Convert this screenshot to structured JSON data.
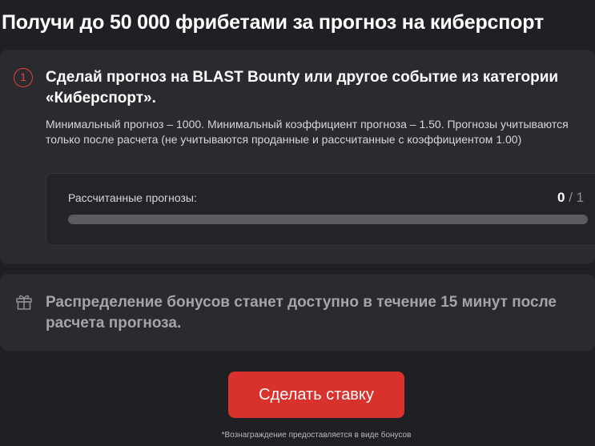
{
  "page": {
    "title": "Получи до 50 000 фрибетами за прогноз на киберспорт"
  },
  "step": {
    "number": "1",
    "title": "Сделай прогноз на BLAST Bounty или другое событие из категории «Киберспорт».",
    "description": "Минимальный прогноз – 1000. Минимальный коэффициент прогноза – 1.50. Прогнозы учитываются только после расчета (не учитываются проданные и рассчитанные с коэффициентом 1.00)"
  },
  "progress": {
    "label": "Рассчитанные прогнозы:",
    "current": "0",
    "separator": "/",
    "total": "1",
    "fraction": 0
  },
  "bonus": {
    "icon": "gift-icon",
    "text": "Распределение бонусов станет доступно в течение 15 минут после расчета прогноза."
  },
  "cta": {
    "label": "Сделать ставку"
  },
  "footnote": "*Вознаграждение предоставляется в виде бонусов",
  "colors": {
    "accent": "#d9322c",
    "background": "#1f2023",
    "card": "#2a2b2f"
  }
}
